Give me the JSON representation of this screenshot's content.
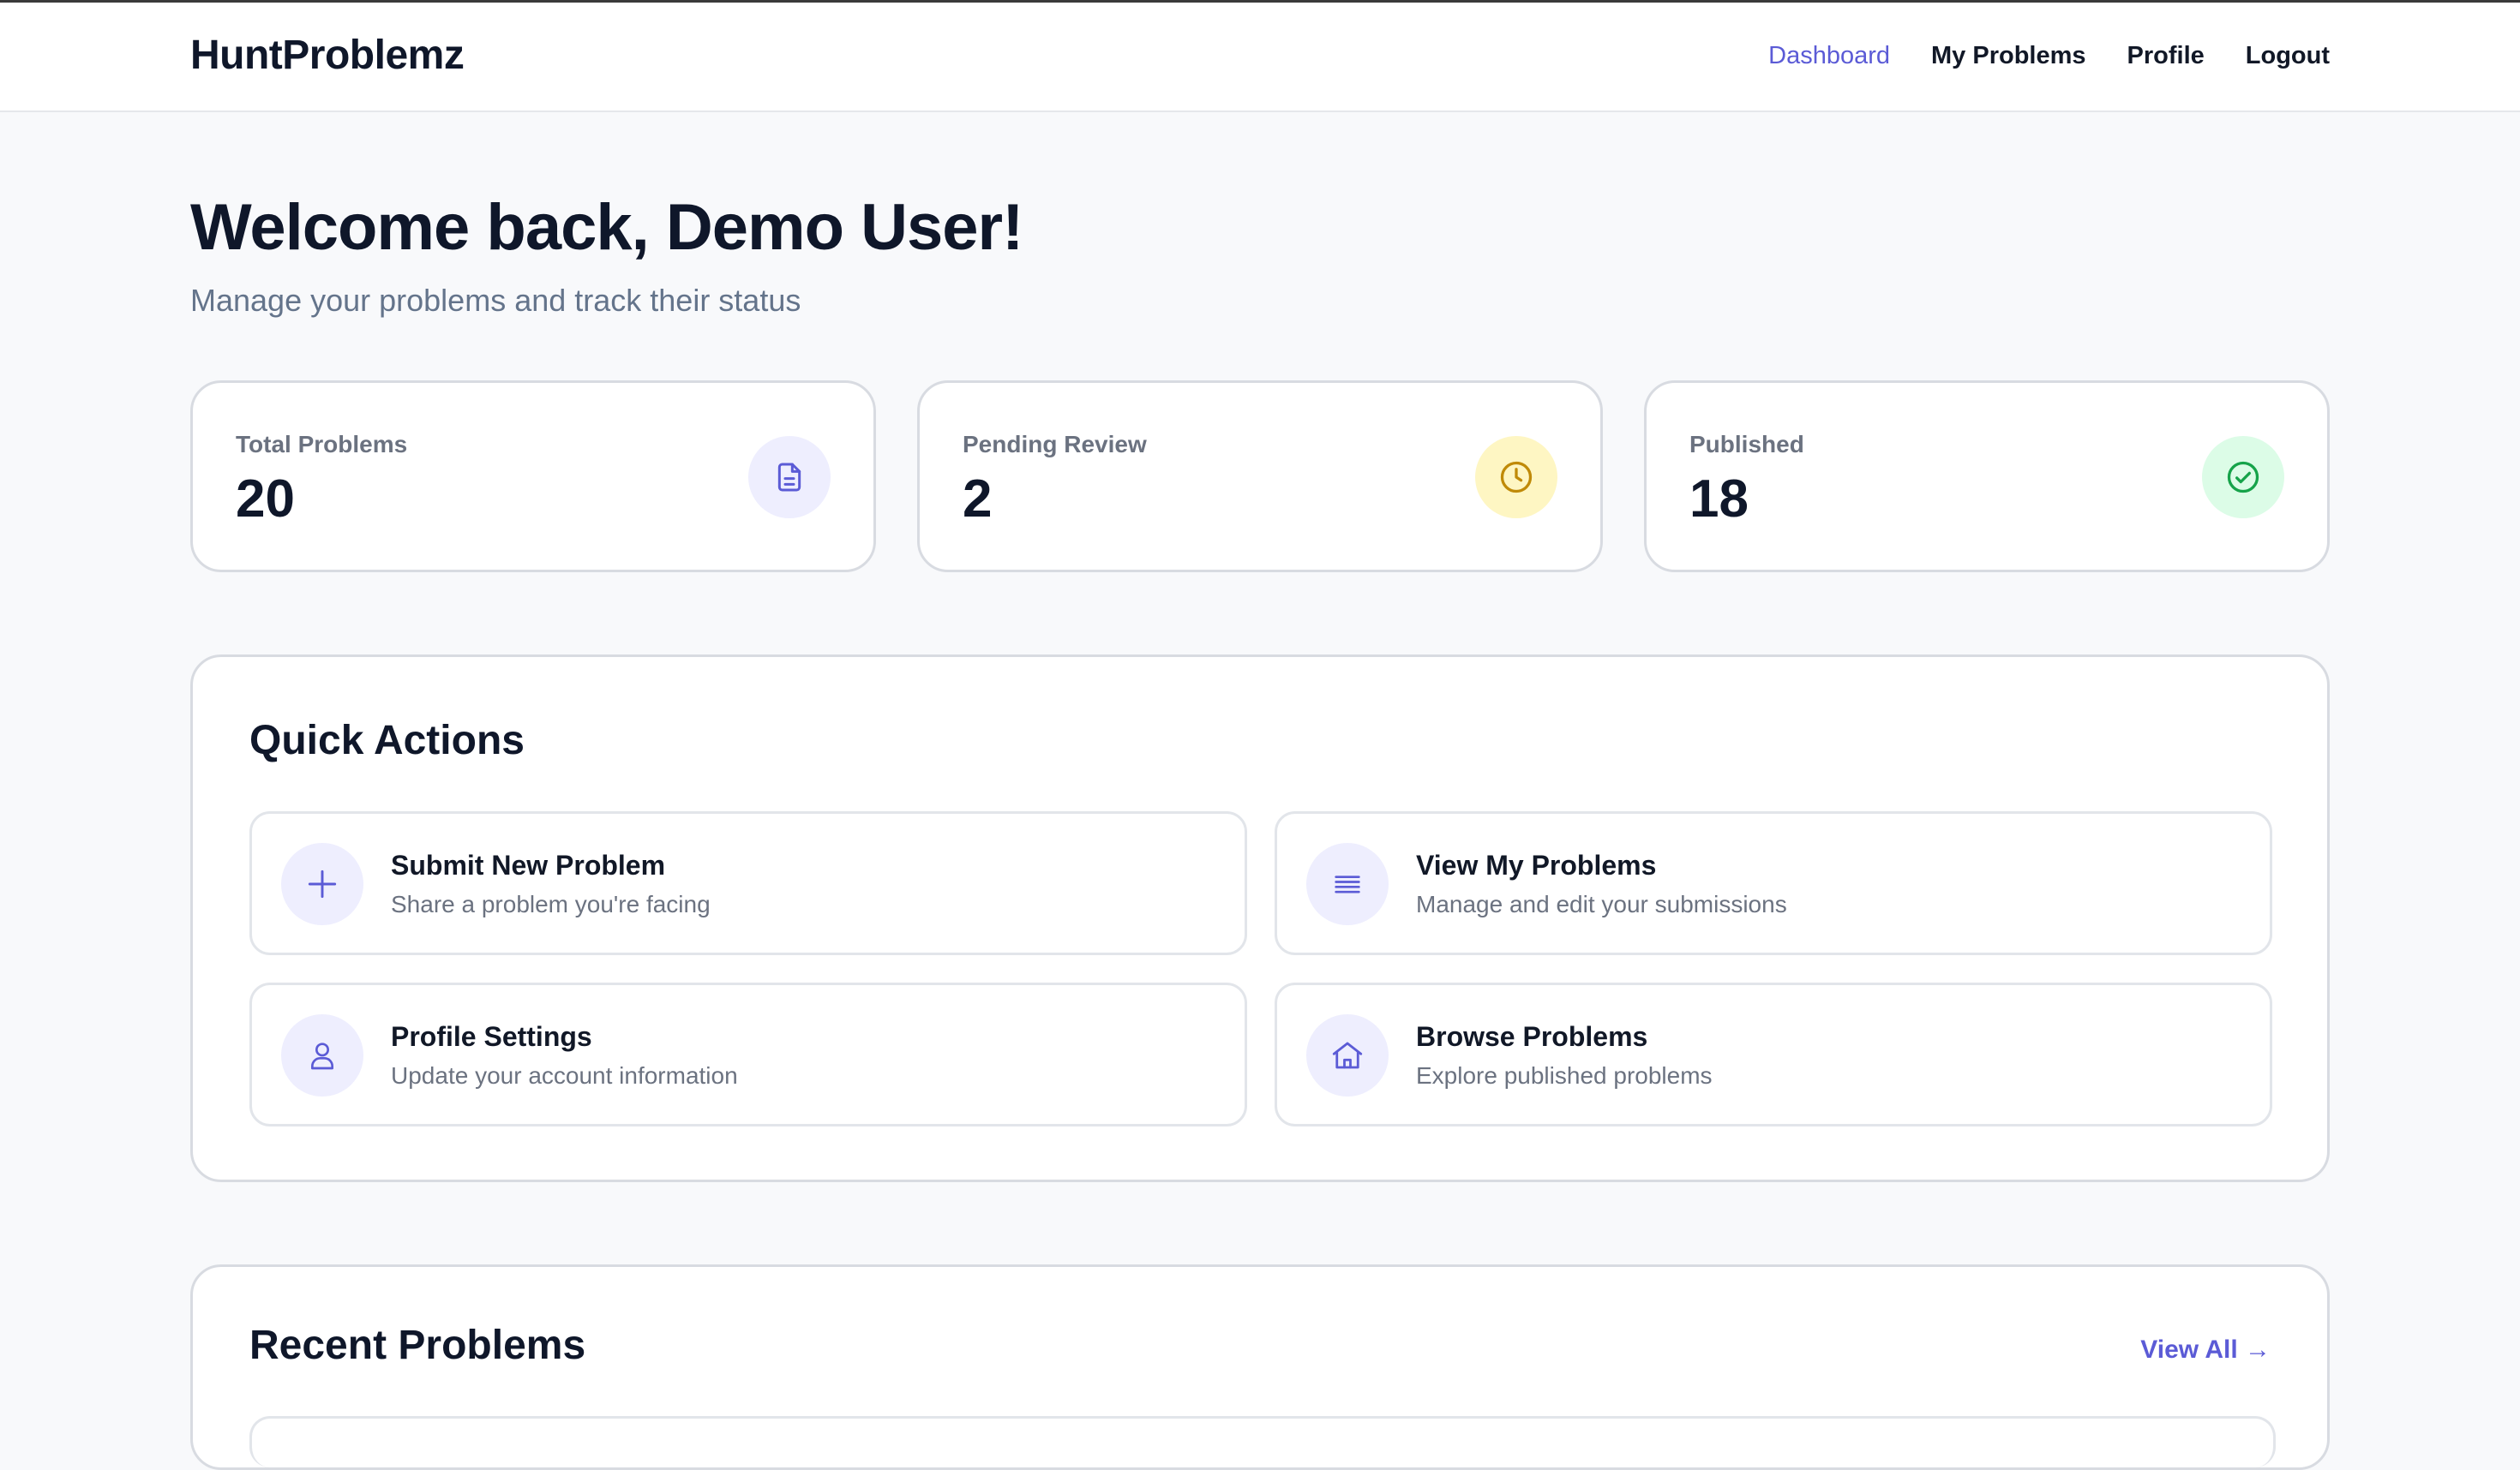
{
  "nav": {
    "brand": "HuntProblemz",
    "links": [
      "Dashboard",
      "My Problems",
      "Profile",
      "Logout"
    ]
  },
  "header": {
    "title": "Welcome back, Demo User!",
    "subtitle": "Manage your problems and track their status"
  },
  "stats": [
    {
      "label": "Total Problems",
      "value": "20",
      "icon": "document-icon",
      "icon_bg": "#eeeefe",
      "icon_color": "#5b5bd6"
    },
    {
      "label": "Pending Review",
      "value": "2",
      "icon": "clock-icon",
      "icon_bg": "#fef6c3",
      "icon_color": "#c08a08"
    },
    {
      "label": "Published",
      "value": "18",
      "icon": "check-circle-icon",
      "icon_bg": "#dcfce7",
      "icon_color": "#16a34a"
    }
  ],
  "quick_actions": {
    "title": "Quick Actions",
    "items": [
      {
        "title": "Submit New Problem",
        "desc": "Share a problem you're facing",
        "icon": "plus-icon"
      },
      {
        "title": "View My Problems",
        "desc": "Manage and edit your submissions",
        "icon": "list-icon"
      },
      {
        "title": "Profile Settings",
        "desc": "Update your account information",
        "icon": "user-icon"
      },
      {
        "title": "Browse Problems",
        "desc": "Explore published problems",
        "icon": "home-icon"
      }
    ]
  },
  "recent": {
    "title": "Recent Problems",
    "view_all": "View All →"
  },
  "colors": {
    "accent": "#5b5bd6",
    "background": "#f8f9fb",
    "text": "#0f172a",
    "muted": "#64748b"
  }
}
